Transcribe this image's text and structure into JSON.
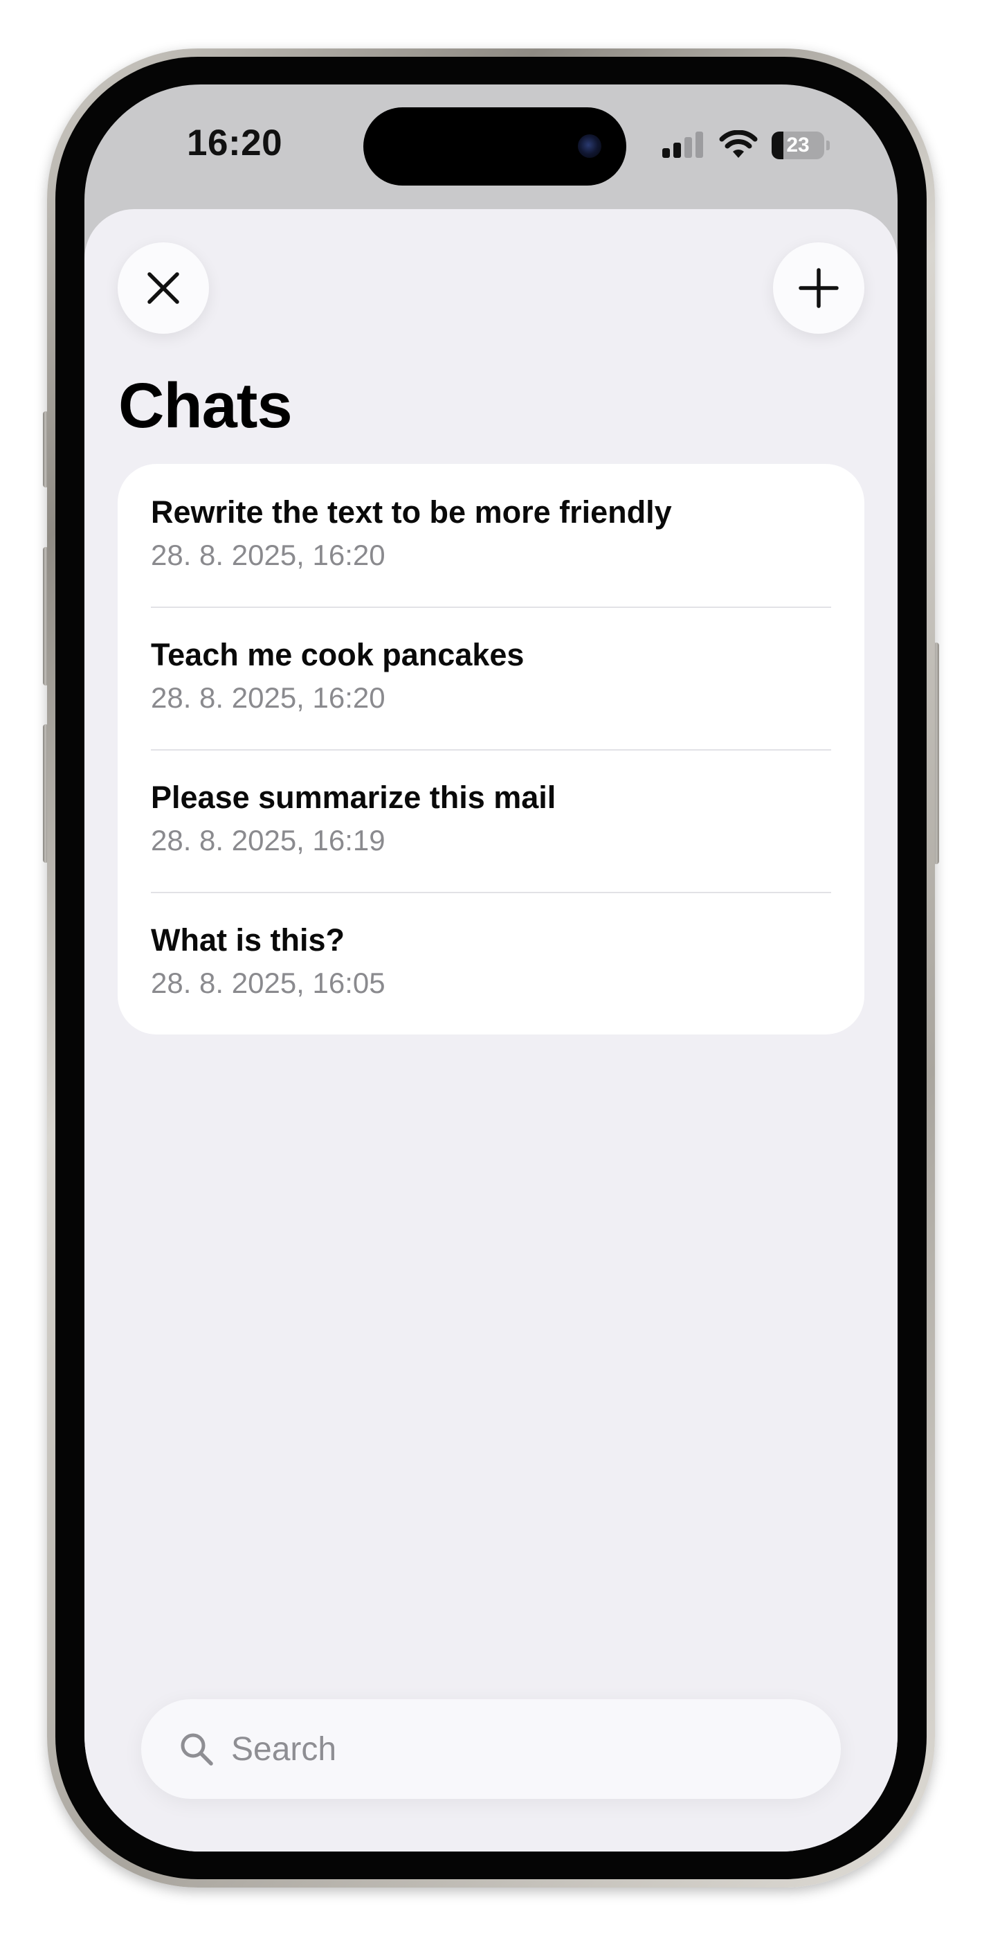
{
  "status_bar": {
    "time": "16:20",
    "battery_level": "23",
    "battery_fraction": 0.23,
    "signal_bars_active": 2,
    "signal_bars_total": 4
  },
  "toolbar": {
    "close_icon": "close-icon",
    "add_icon": "plus-icon"
  },
  "header": {
    "title": "Chats"
  },
  "chats": [
    {
      "title": "Rewrite the text to be more friendly",
      "timestamp": "28. 8. 2025, 16:20"
    },
    {
      "title": "Teach me cook pancakes",
      "timestamp": "28. 8. 2025, 16:20"
    },
    {
      "title": "Please summarize this mail",
      "timestamp": "28. 8. 2025, 16:19"
    },
    {
      "title": "What is this?",
      "timestamp": "28. 8. 2025, 16:05"
    }
  ],
  "search": {
    "placeholder": "Search",
    "value": "",
    "icon": "search-icon"
  },
  "colors": {
    "sheet_background": "#f0eff4",
    "card_background": "#ffffff",
    "secondary_text": "#8a8a8e",
    "primary_text": "#000000"
  }
}
